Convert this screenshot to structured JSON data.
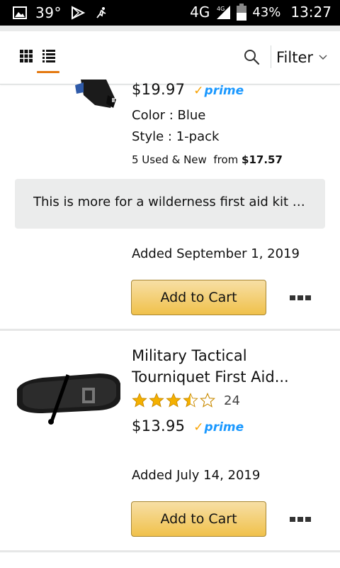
{
  "status_bar": {
    "temperature": "39°",
    "network": "4G",
    "network_small": "4G",
    "battery_percent": "43%",
    "time": "13:27"
  },
  "toolbar": {
    "filter_label": "Filter",
    "active_view": "list",
    "accent_color": "#e47911"
  },
  "items": [
    {
      "price": "$19.97",
      "prime_label": "prime",
      "color": "Color : Blue",
      "style": "Style : 1-pack",
      "offers_prefix": "5 Used & New  from ",
      "offers_price": "$17.57",
      "note": "This is more for a wilderness first aid kit s...",
      "added": "Added September 1, 2019",
      "cart_label": "Add to Cart"
    },
    {
      "title_line1": "Military Tactical",
      "title_line2": "Tourniquet First Aid...",
      "rating": 3.5,
      "rating_count": "24",
      "price": "$13.95",
      "prime_label": "prime",
      "added": "Added July 14, 2019",
      "cart_label": "Add to Cart"
    }
  ]
}
